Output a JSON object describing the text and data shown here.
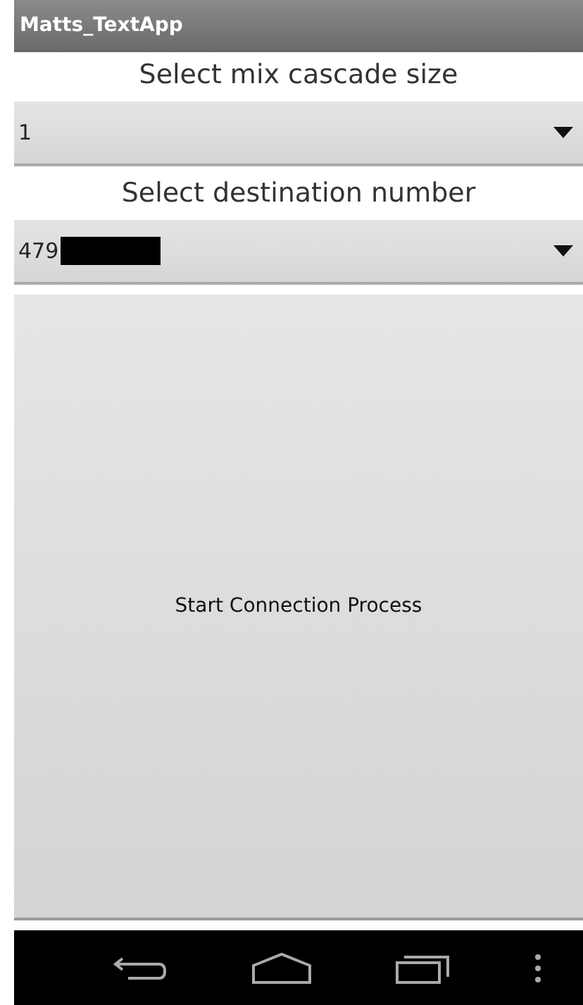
{
  "window": {
    "title": "Matts_TextApp"
  },
  "selectors": [
    {
      "label": "Select mix cascade size",
      "value": "1",
      "redacted": false
    },
    {
      "label": "Select destination number",
      "value": "479",
      "redacted": true
    }
  ],
  "action_button": {
    "label": "Start Connection Process"
  }
}
